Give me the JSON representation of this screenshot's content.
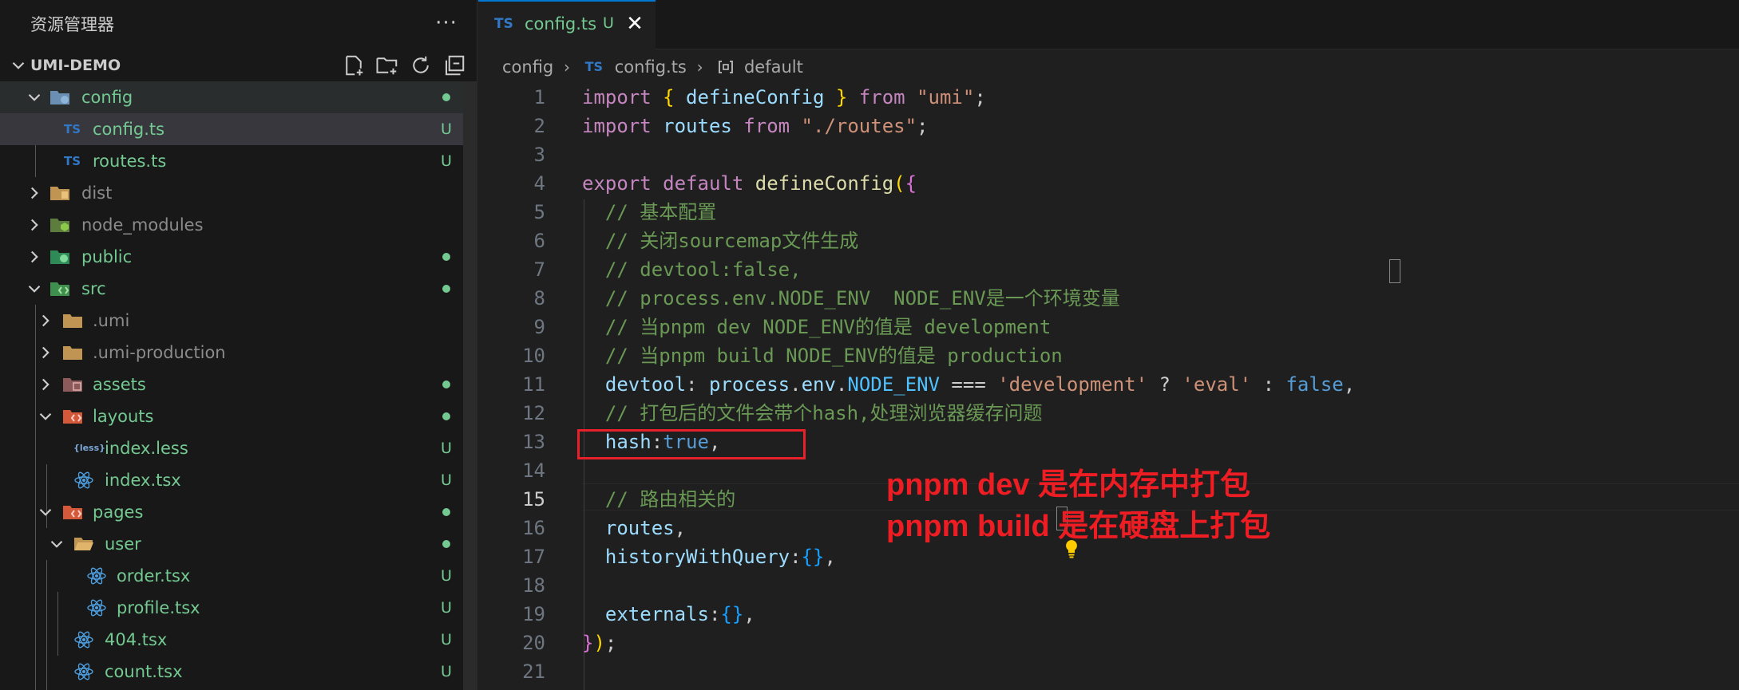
{
  "sidebar": {
    "title": "资源管理器",
    "more": "···",
    "project": "UMI-DEMO",
    "items": [
      {
        "name": "config",
        "status": "dot"
      },
      {
        "name": "config.ts",
        "status": "U"
      },
      {
        "name": "routes.ts",
        "status": "U"
      },
      {
        "name": "dist",
        "status": ""
      },
      {
        "name": "node_modules",
        "status": ""
      },
      {
        "name": "public",
        "status": "dot"
      },
      {
        "name": "src",
        "status": "dot"
      },
      {
        "name": ".umi",
        "status": ""
      },
      {
        "name": ".umi-production",
        "status": ""
      },
      {
        "name": "assets",
        "status": "dot"
      },
      {
        "name": "layouts",
        "status": "dot"
      },
      {
        "name": "index.less",
        "status": "U"
      },
      {
        "name": "index.tsx",
        "status": "U"
      },
      {
        "name": "pages",
        "status": "dot"
      },
      {
        "name": "user",
        "status": "dot"
      },
      {
        "name": "order.tsx",
        "status": "U"
      },
      {
        "name": "profile.tsx",
        "status": "U"
      },
      {
        "name": "404.tsx",
        "status": "U"
      },
      {
        "name": "count.tsx",
        "status": "U"
      }
    ]
  },
  "tab": {
    "lang": "TS",
    "name": "config.ts",
    "status": "U",
    "close": "✕"
  },
  "breadcrumb": {
    "folder": "config",
    "lang": "TS",
    "file": "config.ts",
    "symbol": "default"
  },
  "editor": {
    "active_line": 15,
    "line_numbers": [
      "1",
      "2",
      "3",
      "4",
      "5",
      "6",
      "7",
      "8",
      "9",
      "10",
      "11",
      "12",
      "13",
      "14",
      "15",
      "16",
      "17",
      "18",
      "19",
      "20",
      "21"
    ],
    "lines": {
      "l1": {
        "a": "import",
        "b": " ",
        "c": "{",
        "d": " defineConfig ",
        "e": "}",
        "f": " from ",
        "g": "\"umi\"",
        "h": ";"
      },
      "l2": {
        "a": "import",
        "b": " routes ",
        "c": "from",
        "d": " ",
        "e": "\"./routes\"",
        "f": ";"
      },
      "l4": {
        "a": "export",
        "b": " ",
        "c": "default",
        "d": " ",
        "e": "defineConfig",
        "f": "(",
        "g": "{"
      },
      "l5": "  // 基本配置",
      "l6": "  // 关闭sourcemap文件生成",
      "l7": "  // devtool:false,",
      "l8": "  // process.env.NODE_ENV  NODE_ENV是一个环境变量",
      "l9": "  // 当pnpm dev NODE_ENV的值是 development",
      "l10": "  // 当pnpm build NODE_ENV的值是 production",
      "l11": {
        "a": "  devtool",
        "b": ": ",
        "c": "process",
        "d": ".",
        "e": "env",
        "f": ".",
        "g": "NODE_ENV",
        "h": " === ",
        "i": "'development'",
        "j": " ? ",
        "k": "'eval'",
        "l": " : ",
        "m": "false",
        "n": ","
      },
      "l12": "  // 打包后的文件会带个hash,处理浏览器缓存问题",
      "l13": {
        "a": "  hash",
        "b": ":",
        "c": "true",
        "d": ","
      },
      "l15": "  // 路由相关的",
      "l16": {
        "a": "  routes",
        "b": ","
      },
      "l17": {
        "a": "  historyWithQuery",
        "b": ":",
        "c": "{}",
        "d": ","
      },
      "l19": {
        "a": "  externals",
        "b": ":",
        "c": "{}",
        "d": ","
      },
      "l20": {
        "a": "}",
        "b": ")",
        "c": ";"
      }
    }
  },
  "annotation": {
    "line1": "pnpm dev  是在内存中打包",
    "line2": "pnpm build 是在硬盘上打包",
    "color": "#ee1d23"
  }
}
